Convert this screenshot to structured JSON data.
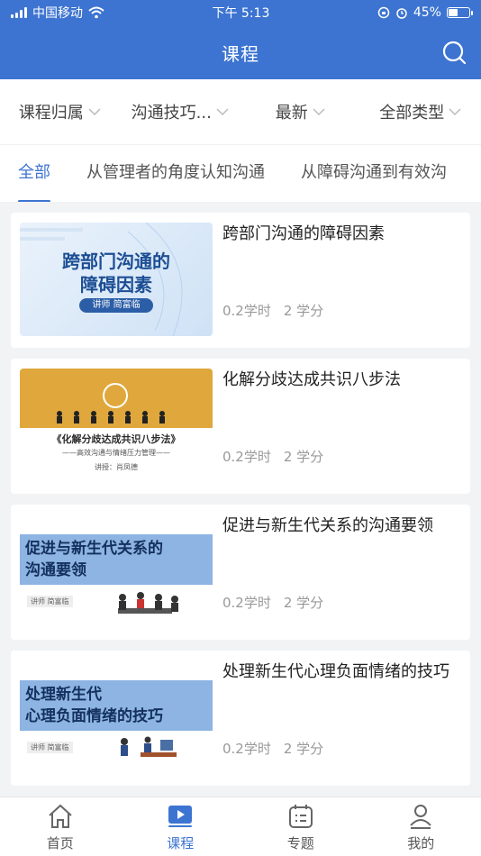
{
  "status": {
    "carrier": "中国移动",
    "time": "下午 5:13",
    "battery": "45%",
    "battery_level": 0.45
  },
  "header": {
    "title": "课程",
    "search_icon": "search-icon"
  },
  "filters": [
    {
      "label": "课程归属"
    },
    {
      "label": "沟通技巧..."
    },
    {
      "label": "最新"
    },
    {
      "label": "全部类型"
    }
  ],
  "tabs": [
    {
      "label": "全部",
      "active": true
    },
    {
      "label": "从管理者的角度认知沟通"
    },
    {
      "label": "从障碍沟通到有效沟"
    }
  ],
  "courses": [
    {
      "title": "跨部门沟通的障碍因素",
      "hours": "0.2学时",
      "credits": "2 学分",
      "thumb": {
        "text1": "跨部门沟通的",
        "text2": "障碍因素",
        "lecturer": "讲师  简富临"
      }
    },
    {
      "title": "化解分歧达成共识八步法",
      "hours": "0.2学时",
      "credits": "2 学分",
      "thumb": {
        "text1": "《化解分歧达成共识八步法》",
        "text2": "——高效沟通与情绪压力管理——",
        "lecturer": "讲授：肖凤德"
      }
    },
    {
      "title": "促进与新生代关系的沟通要领",
      "hours": "0.2学时",
      "credits": "2 学分",
      "thumb": {
        "text1": "促进与新生代关系的",
        "text2": "沟通要领",
        "lecturer": "讲师  简富临"
      }
    },
    {
      "title": "处理新生代心理负面情绪的技巧",
      "hours": "0.2学时",
      "credits": "2 学分",
      "thumb": {
        "text1": "处理新生代",
        "text2": "心理负面情绪的技巧",
        "lecturer": "讲师  简富临"
      }
    }
  ],
  "bottom_nav": [
    {
      "label": "首页",
      "icon": "home-icon"
    },
    {
      "label": "课程",
      "icon": "play-icon",
      "active": true
    },
    {
      "label": "专题",
      "icon": "topic-icon"
    },
    {
      "label": "我的",
      "icon": "user-icon"
    }
  ],
  "colors": {
    "primary": "#3d74d1",
    "background": "#f2f3f5"
  }
}
